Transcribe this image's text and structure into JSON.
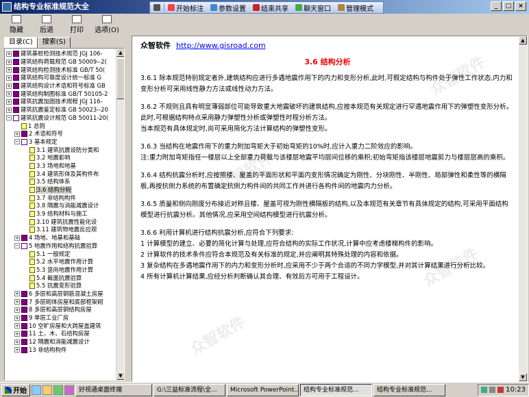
{
  "window": {
    "title": "结构专业标准规范大全"
  },
  "floatbar": {
    "items": [
      "开始标注",
      "参数设置",
      "结束共享",
      "聊天窗口",
      "管理模式"
    ]
  },
  "toolbar": {
    "buttons": [
      "隐藏",
      "后退",
      "打印",
      "选项(O)"
    ]
  },
  "left_tabs": [
    "目录(C)",
    "搜索(S)"
  ],
  "tree": [
    {
      "level": 0,
      "type": "book",
      "label": "建筑基桩检测技术规范 JGJ 106-"
    },
    {
      "level": 0,
      "type": "book",
      "label": "建筑结构荷载规范 GB 50009--2("
    },
    {
      "level": 0,
      "type": "book",
      "label": "建筑结构检测技术标准 GB/T 50("
    },
    {
      "level": 0,
      "type": "book",
      "label": "建筑结构可靠度设计统一标准 G"
    },
    {
      "level": 0,
      "type": "book",
      "label": "建筑结构设计术语和符号标准 GB"
    },
    {
      "level": 0,
      "type": "book",
      "label": "建筑结构制图标准 GB/T 50105-2"
    },
    {
      "level": 0,
      "type": "book",
      "label": "建筑抗震加固技术规程 JGJ 116-"
    },
    {
      "level": 0,
      "type": "book",
      "label": "建筑抗震鉴定标准 GB 50023--20"
    },
    {
      "level": 0,
      "type": "open",
      "label": "建筑抗震设计规范 GB 50011-20("
    },
    {
      "level": 1,
      "type": "page",
      "label": "1 总则"
    },
    {
      "level": 1,
      "type": "book",
      "label": "2 术语和符号"
    },
    {
      "level": 1,
      "type": "open",
      "label": "3 基本规定"
    },
    {
      "level": 2,
      "type": "page",
      "label": "3.1 建筑抗震设防分类和"
    },
    {
      "level": 2,
      "type": "page",
      "label": "3.2 地震影响"
    },
    {
      "level": 2,
      "type": "page",
      "label": "3.3 场地和地基"
    },
    {
      "level": 2,
      "type": "page",
      "label": "3.4 建筑形体及其构件布"
    },
    {
      "level": 2,
      "type": "page",
      "label": "3.5 结构体系"
    },
    {
      "level": 2,
      "type": "page",
      "label": "3.6 结构分析",
      "selected": true
    },
    {
      "level": 2,
      "type": "page",
      "label": "3.7 非结构构件"
    },
    {
      "level": 2,
      "type": "page",
      "label": "3.8 隔震与消能减震设计"
    },
    {
      "level": 2,
      "type": "page",
      "label": "3.9 结构材料与施工"
    },
    {
      "level": 2,
      "type": "page",
      "label": "3.10 建筑抗震性能化设"
    },
    {
      "level": 2,
      "type": "page",
      "label": "3.11 建筑物地震反应观"
    },
    {
      "level": 1,
      "type": "book",
      "label": "4 场地、地基和基础"
    },
    {
      "level": 1,
      "type": "open",
      "label": "5 地震作用和结构抗震验算"
    },
    {
      "level": 2,
      "type": "page",
      "label": "5.1 一般规定"
    },
    {
      "level": 2,
      "type": "page",
      "label": "5.2 水平地震作用计算"
    },
    {
      "level": 2,
      "type": "page",
      "label": "5.3 竖向地震作用计算"
    },
    {
      "level": 2,
      "type": "page",
      "label": "5.4 截面抗震验算"
    },
    {
      "level": 2,
      "type": "page",
      "label": "5.5 抗震变形验算"
    },
    {
      "level": 1,
      "type": "book",
      "label": "6 多层和高层钢筋混凝土房屋"
    },
    {
      "level": 1,
      "type": "book",
      "label": "7 多层砌体房屋和底部框架砌"
    },
    {
      "level": 1,
      "type": "book",
      "label": "8 多层和高层钢结构房屋"
    },
    {
      "level": 1,
      "type": "book",
      "label": "9 单层工业厂房"
    },
    {
      "level": 1,
      "type": "book",
      "label": "10 空旷房屋和大跨屋盖建筑"
    },
    {
      "level": 1,
      "type": "book",
      "label": "11 土、木、石结构房屋"
    },
    {
      "level": 1,
      "type": "book",
      "label": "12 隔震和消能减震设计"
    },
    {
      "level": 1,
      "type": "book",
      "label": "13 非结构构件"
    }
  ],
  "content": {
    "brand": "众智软件",
    "url": "http://www.gisroad.com",
    "section_title": "3.6 结构分析",
    "paragraphs": [
      [
        "3.6.1 除本规范特别规定者外,建筑结构应进行多遇地震作用下的内力和变形分析,此时,可假定结构与构件处于弹性工作状态,内力和变形分析可采用线性静力方法或线性动力方法。"
      ],
      [
        "3.6.2 不规则且具有明显薄弱部位可能导致重大地震破坏的建筑结构,应按本规范有关规定进行罕遇地震作用下的弹塑性变形分析。此时,可根据结构特点采用静力弹塑性分析或弹塑性时程分析方法。",
        "当本规范有具体规定时,尚可采用简化方法计算结构的弹塑性变形。"
      ],
      [
        "3.6.3 当结构在地震作用下的重力附加弯矩大于初始弯矩的10%时,应计入重力二阶效应的影响。",
        "注:重力附加弯矩指任一楼层以上全部重力荷载与该楼层地震平均层间位移的乘积;初始弯矩指该楼层地震剪力与楼层层高的乘积。"
      ],
      [
        "3.6.4 结构抗震分析时,应按照楼、屋盖的平面形状和平面内变形情况确定为刚性、分块刚性、半刚性、局部弹性和柔性等的横隔板,再按抗侧力系统的布置确定抗侧力构件间的共同工作并进行各构件间的地震内力分析。"
      ],
      [
        "3.6.5 质量和侧向刚度分布接近对称且楼、屋盖可视为刚性横隔板的结构,以及本规范有关章节有具体规定的结构,可采用平面结构模型进行抗震分析。其他情况,应采用空间结构模型进行抗震分析。"
      ],
      [
        "3.6.6 利用计算机进行结构抗震分析,应符合下列要求:",
        "1 计算模型的建立、必要的简化计算与处理,应符合结构的实际工作状况,计算中应考虑楼梯构件的影响。",
        "2 计算软件的技术条件应符合本规范及有关标准的规定,并应阐明其特殊处理的内容和依据。",
        "3 复杂结构在多遇地震作用下的内力和变形分析时,应采用不少于两个合适的不同力学模型,并对其计算结果进行分析比较。",
        "4 所有计算机计算结果,应经分析判断确认其合理、有效后方可用于工程设计。"
      ]
    ]
  },
  "taskbar": {
    "start": "开始",
    "tasks": [
      "好视通桌面终端",
      "G:\\三益标准流程\\全...",
      "Microsoft PowerPoint...",
      "结构专业标准规范...",
      "结构专业标准规范..."
    ],
    "clock": "10:23"
  }
}
